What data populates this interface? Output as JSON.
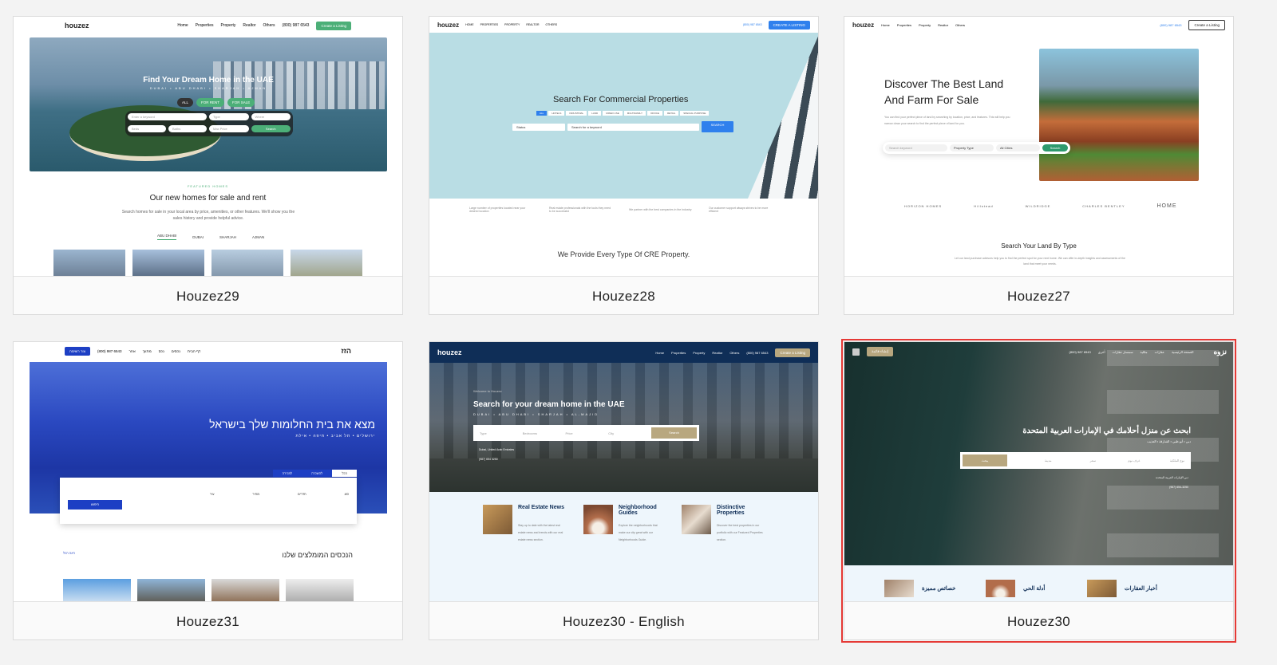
{
  "cards": [
    {
      "label": "Houzez29",
      "logo": "houzez",
      "nav": [
        "Home",
        "Properties",
        "Property",
        "Realtor",
        "Others"
      ],
      "phone": "(800) 987 6543",
      "cta": "Create a Listing",
      "hero_title": "Find Your Dream Home in the UAE",
      "hero_sub": "DUBAI • ABU DHABI • SHARJAH • AJMAN",
      "tabs": [
        "ALL",
        "FOR RENT",
        "FOR SALE"
      ],
      "fields": [
        "Enter a keyword",
        "Type",
        "Where",
        "Beds",
        "Baths",
        "Max Price"
      ],
      "search": "Search",
      "eyebrow": "FEATURED HOMES",
      "section_title": "Our new homes for sale and rent",
      "section_text": "Search homes for sale in your local area by price, amenities, or other features. We'll show you the sales history and provide helpful advice.",
      "city_tabs": [
        "ABU DHABI",
        "DUBAI",
        "SHARJAH",
        "AJMAN"
      ]
    },
    {
      "label": "Houzez28",
      "logo": "houzez",
      "nav": [
        "HOME",
        "PROPERTIES",
        "PROPERTY",
        "REALTOR",
        "OTHERS"
      ],
      "phone": "(800) 987 6543",
      "cta": "CREATE A LISTING",
      "hero_title": "Search For Commercial Properties",
      "tabs": [
        "ALL",
        "HOTELS",
        "INDUSTRIAL",
        "LAND",
        "MIXED USE",
        "MULTIFAMILY",
        "OFFICE",
        "RETAIL",
        "SPECIAL PURPOSE"
      ],
      "fields": [
        "Status",
        "Search for a keyword"
      ],
      "search": "SEARCH",
      "features": [
        "Large number of properties located near your desired location",
        "Real estate professionals with the tools they need to be successful",
        "We partner with the best companies in the industry",
        "Our customer support always strives to be more efficient"
      ],
      "section_title": "We Provide Every Type Of CRE Property."
    },
    {
      "label": "Houzez27",
      "logo": "houzez",
      "nav": [
        "Home",
        "Properties",
        "Property",
        "Realtor",
        "Others"
      ],
      "phone": "(800) 987 6543",
      "cta": "Create a Listing",
      "hero_title": "Discover The Best Land And Farm For Sale",
      "hero_text": "You can find your perfect piece of land by searching by location, price, and features. This will help you narrow down your search to find the perfect piece of land for you.",
      "fields": [
        "Search keyword",
        "Property Type",
        "All Cities"
      ],
      "search": "Search",
      "partners": [
        "HORIZON HOMES",
        "Hillstead",
        "WILDRIDGE",
        "CHARLES BENTLEY",
        "HOME"
      ],
      "section_title": "Search Your Land By Type",
      "section_text": "Let our land purchase advisors help you to find the perfect spot for your next home. We can offer in-depth insights and assessments of the land that meet your needs."
    },
    {
      "label": "Houzez31",
      "logo": "הזז",
      "nav": [
        "דף הבית",
        "נכסים",
        "נכס",
        "מתווך",
        "אחר"
      ],
      "phone": "(800) 987 6543",
      "cta": "צור רשימה",
      "hero_title": "מצא את בית החלומות שלך בישראל",
      "hero_sub": "ירושלים • תל אביב • חיפה • אילת",
      "tabs": [
        "הכל",
        "להשכרה",
        "למכירה"
      ],
      "fields": [
        "סוג",
        "חדרים",
        "מחיר",
        "עיר"
      ],
      "search": "חיפוש",
      "section_title": "הנכסים המומלצים שלנו",
      "link": "ראה הכל"
    },
    {
      "label": "Houzez30 - English",
      "logo": "houzez",
      "nav": [
        "Home",
        "Properties",
        "Property",
        "Realtor",
        "Others"
      ],
      "phone": "(800) 987 6543",
      "cta": "Create a Listing",
      "eyebrow": "Welcome to Houzez",
      "hero_title": "Search for your dream home in the UAE",
      "hero_sub": "DUBAI • ABU DHABI • SHARJAH • AL-MAJID",
      "fields": [
        "Type",
        "Bedrooms",
        "Price",
        "City"
      ],
      "search": "Search",
      "address": "Dubai, United Arab Emirates",
      "contact": "(987) 654 3250",
      "features": [
        {
          "title": "Real Estate News",
          "text": "Stay up to date with the latest real estate news and trends with our real estate news section."
        },
        {
          "title": "Neighborhood Guides",
          "text": "Explore the neighborhoods that make our city great with our Neighborhoods Guide."
        },
        {
          "title": "Distinctive Properties",
          "text": "Discover the best properties in our portfolio with our Featured Properties section."
        }
      ]
    },
    {
      "label": "Houzez30",
      "logo": "نزوه",
      "nav": [
        "الصفحة الرئيسية",
        "عقارات",
        "ملكية",
        "سمسار عقارات",
        "أخرى"
      ],
      "phone": "(800) 987 6543",
      "cta": "إنشاء قائمة",
      "hero_title": "ابحث عن منزل أحلامك في الإمارات العربية المتحدة",
      "hero_sub": "دبي • أبو ظبي • الشارقة • العذيب",
      "fields": [
        "نوع الملكية",
        "غرف نوم",
        "سعر",
        "مدينة"
      ],
      "search": "يبحث",
      "address": "دبي الإمارات العربية المتحدة",
      "contact": "(987) 654-3250",
      "features": [
        "خصائص مميزة",
        "أدلة الحي",
        "أخبار العقارات"
      ]
    }
  ],
  "colors": {
    "green": "#4caf78",
    "blue": "#2f80ed",
    "navy": "#0f2e57",
    "gold": "#b8a77f",
    "hebrew_blue": "#1d3fc4",
    "selected": "#e53935"
  }
}
